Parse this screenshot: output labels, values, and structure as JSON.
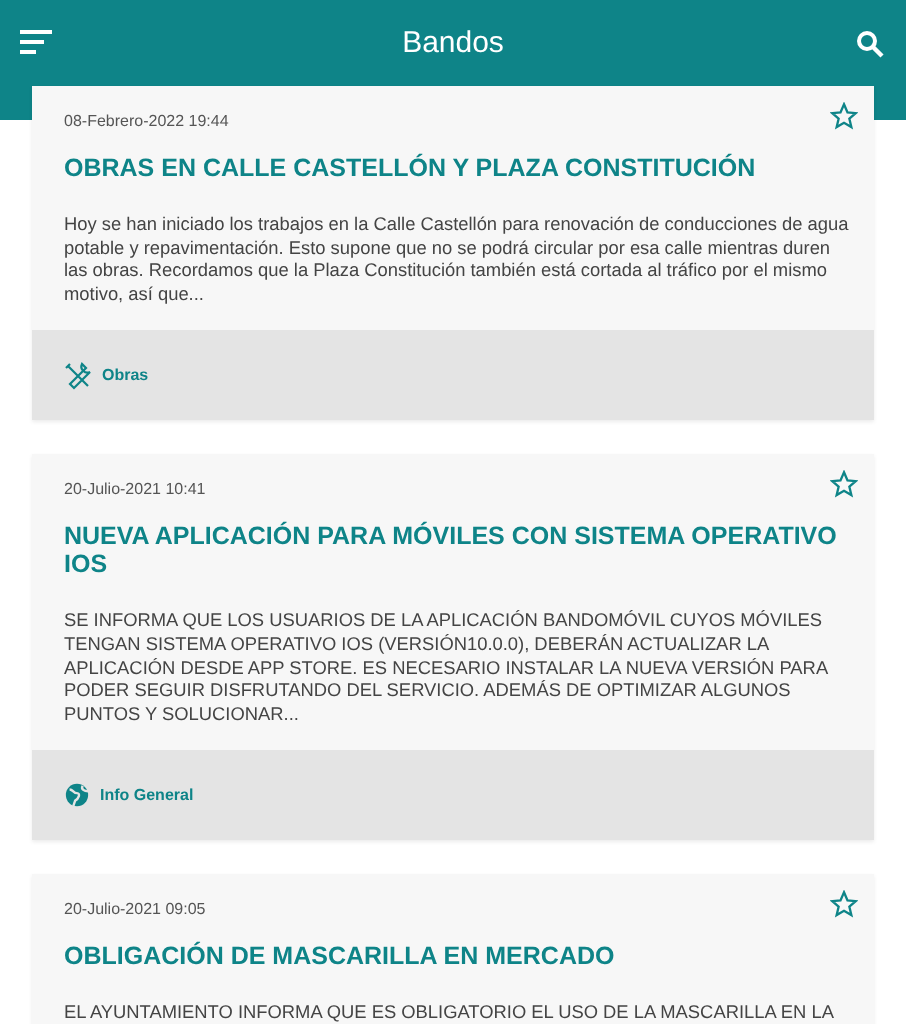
{
  "app_bar": {
    "title": "Bandos"
  },
  "items": [
    {
      "date": "08-Febrero-2022 19:44",
      "title": "OBRAS EN CALLE CASTELLÓN Y PLAZA CONSTITUCIÓN",
      "body": "Hoy se han iniciado los trabajos en la Calle Castellón para renovación de conducciones de agua potable y repavimentación. Esto supone que no se podrá circular por esa calle mientras duren las obras. Recordamos que la Plaza Constitución también está cortada al tráfico por el mismo motivo, así que...",
      "favorite": false,
      "category": {
        "label": "Obras",
        "kind": "tools"
      }
    },
    {
      "date": "20-Julio-2021 10:41",
      "title": "NUEVA APLICACIÓN PARA MÓVILES CON SISTEMA OPERATIVO IOS",
      "body": "SE INFORMA QUE LOS USUARIOS DE LA APLICACIÓN BANDOMÓVIL CUYOS MÓVILES TENGAN SISTEMA OPERATIVO IOS (VERSIÓN10.0.0), DEBERÁN ACTUALIZAR LA APLICACIÓN DESDE APP STORE. ES NECESARIO INSTALAR LA NUEVA VERSIÓN PARA PODER SEGUIR DISFRUTANDO DEL SERVICIO. ADEMÁS DE OPTIMIZAR ALGUNOS PUNTOS Y SOLUCIONAR...",
      "favorite": false,
      "category": {
        "label": "Info General",
        "kind": "globe"
      }
    },
    {
      "date": "20-Julio-2021 09:05",
      "title": "OBLIGACIÓN DE MASCARILLA EN MERCADO",
      "body": "EL AYUNTAMIENTO INFORMA QUE ES OBLIGATORIO EL USO DE LA MASCARILLA EN LA",
      "favorite": false
    }
  ]
}
